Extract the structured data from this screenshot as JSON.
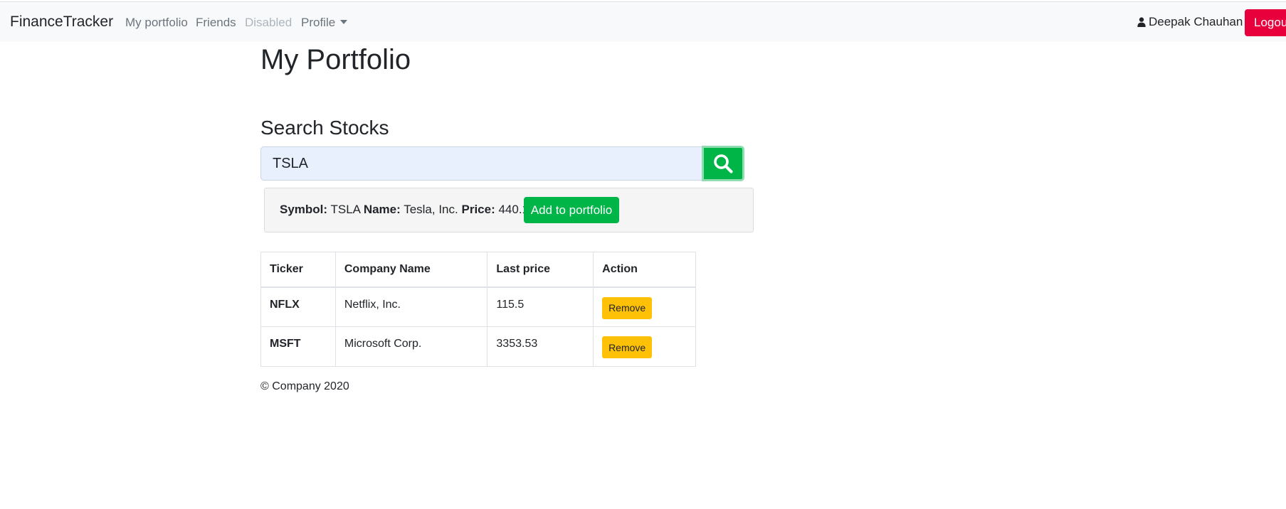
{
  "navbar": {
    "brand": "FinanceTracker",
    "links": [
      {
        "label": "My portfolio",
        "state": "normal"
      },
      {
        "label": "Friends",
        "state": "normal"
      },
      {
        "label": "Disabled",
        "state": "disabled"
      },
      {
        "label": "Profile",
        "state": "dropdown"
      }
    ],
    "user_name": "Deepak Chauhan",
    "user_icon": "user-icon",
    "logout_label": "Logou"
  },
  "main": {
    "title": "My Portfolio",
    "search": {
      "heading": "Search Stocks",
      "value": "TSLA",
      "button_icon": "search-icon"
    },
    "result": {
      "symbol_label": "Symbol:",
      "symbol": "TSLA",
      "name_label": "Name:",
      "name": "Tesla, Inc.",
      "price_label": "Price:",
      "price": "440.16",
      "add_label": "Add to portfolio"
    },
    "table": {
      "headers": [
        "Ticker",
        "Company Name",
        "Last price",
        "Action"
      ],
      "rows": [
        {
          "ticker": "NFLX",
          "company": "Netflix, Inc.",
          "price": "115.5",
          "action": "Remove"
        },
        {
          "ticker": "MSFT",
          "company": "Microsoft Corp.",
          "price": "3353.53",
          "action": "Remove"
        }
      ]
    }
  },
  "footer": {
    "text": "© Company 2020"
  },
  "colors": {
    "success": "#00b548",
    "warning": "#ffc107",
    "danger": "#e8003d",
    "navbar_bg": "#f8f9fa",
    "input_bg": "#e8f0fe"
  }
}
